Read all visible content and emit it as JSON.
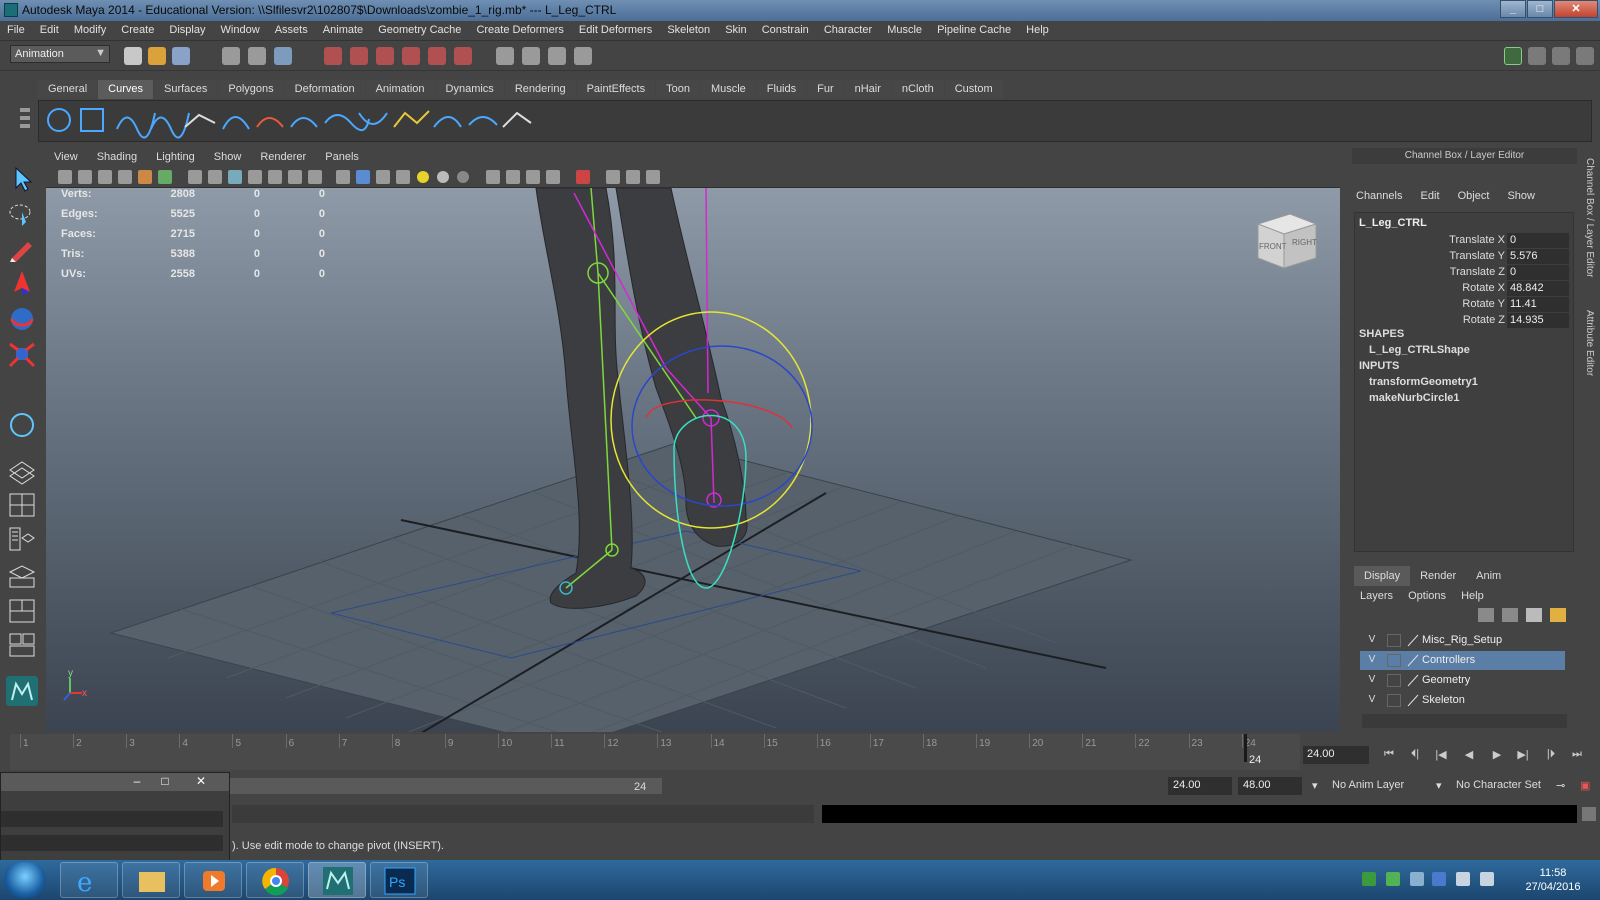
{
  "window": {
    "title": "Autodesk Maya 2014 - Educational Version: \\\\Slfilesvr2\\102807$\\Downloads\\zombie_1_rig.mb*   ---   L_Leg_CTRL"
  },
  "menubar": {
    "items": [
      "File",
      "Edit",
      "Modify",
      "Create",
      "Display",
      "Window",
      "Assets",
      "Animate",
      "Geometry Cache",
      "Create Deformers",
      "Edit Deformers",
      "Skeleton",
      "Skin",
      "Constrain",
      "Character",
      "Muscle",
      "Pipeline Cache",
      "Help"
    ]
  },
  "statusline": {
    "mode": "Animation"
  },
  "shelf": {
    "tabs": [
      "General",
      "Curves",
      "Surfaces",
      "Polygons",
      "Deformation",
      "Animation",
      "Dynamics",
      "Rendering",
      "PaintEffects",
      "Toon",
      "Muscle",
      "Fluids",
      "Fur",
      "nHair",
      "nCloth",
      "Custom"
    ],
    "active_tab": "Curves"
  },
  "viewport": {
    "menu": [
      "View",
      "Shading",
      "Lighting",
      "Show",
      "Renderer",
      "Panels"
    ],
    "hud": [
      {
        "label": "Verts:",
        "values": [
          "2808",
          "0",
          "0"
        ]
      },
      {
        "label": "Edges:",
        "values": [
          "5525",
          "0",
          "0"
        ]
      },
      {
        "label": "Faces:",
        "values": [
          "2715",
          "0",
          "0"
        ]
      },
      {
        "label": "Tris:",
        "values": [
          "5388",
          "0",
          "0"
        ]
      },
      {
        "label": "UVs:",
        "values": [
          "2558",
          "0",
          "0"
        ]
      }
    ],
    "viewcube": {
      "front": "FRONT",
      "right": "RIGHT"
    },
    "axis": {
      "x": "x",
      "y": "y"
    }
  },
  "channel_box": {
    "header": "Channel Box / Layer Editor",
    "menu": [
      "Channels",
      "Edit",
      "Object",
      "Show"
    ],
    "object": "L_Leg_CTRL",
    "channels": [
      {
        "name": "Translate X",
        "value": "0"
      },
      {
        "name": "Translate Y",
        "value": "5.576"
      },
      {
        "name": "Translate Z",
        "value": "0"
      },
      {
        "name": "Rotate X",
        "value": "48.842"
      },
      {
        "name": "Rotate Y",
        "value": "11.41"
      },
      {
        "name": "Rotate Z",
        "value": "14.935"
      }
    ],
    "shapes_label": "SHAPES",
    "shape": "L_Leg_CTRLShape",
    "inputs_label": "INPUTS",
    "inputs": [
      "transformGeometry1",
      "makeNurbCircle1"
    ],
    "side_tabs": [
      "Channel Box / Layer Editor",
      "Attribute Editor"
    ]
  },
  "layer_editor": {
    "tabs": [
      "Display",
      "Render",
      "Anim"
    ],
    "active_tab": "Display",
    "menu": [
      "Layers",
      "Options",
      "Help"
    ],
    "layers": [
      {
        "vis": "V",
        "name": "Misc_Rig_Setup",
        "selected": false
      },
      {
        "vis": "V",
        "name": "Controllers",
        "selected": true
      },
      {
        "vis": "V",
        "name": "Geometry",
        "selected": false
      },
      {
        "vis": "V",
        "name": "Skeleton",
        "selected": false
      }
    ]
  },
  "timeline": {
    "ticks": [
      "1",
      "2",
      "3",
      "4",
      "5",
      "6",
      "7",
      "8",
      "9",
      "10",
      "11",
      "12",
      "13",
      "14",
      "15",
      "16",
      "17",
      "18",
      "19",
      "20",
      "21",
      "22",
      "23",
      "24"
    ],
    "current_frame": "24",
    "current_time": "24.00",
    "range_end_label": "24",
    "range_start": "24.00",
    "range_end": "48.00",
    "anim_layer": "No Anim Layer",
    "character_set": "No Character Set"
  },
  "helpline": {
    "text": "). Use edit mode to change pivot (INSERT)."
  },
  "taskbar": {
    "time": "11:58",
    "date": "27/04/2016",
    "apps": [
      "internet-explorer",
      "file-explorer",
      "media-player",
      "chrome",
      "maya",
      "photoshop"
    ]
  },
  "colors": {
    "accent": "#5a7ea5",
    "controller_yellow": "#e6e633",
    "joint_magenta": "#d22ad2",
    "joint_green": "#7fd83a"
  }
}
